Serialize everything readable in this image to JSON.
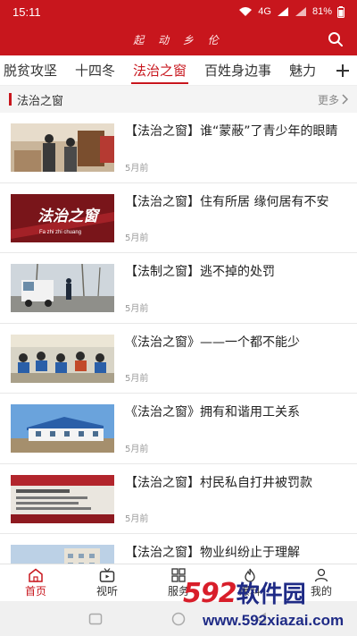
{
  "status": {
    "time": "15:11",
    "network": "4G",
    "battery": "81%"
  },
  "header": {
    "title": "起 动 乡 伦",
    "search_icon": "search-icon",
    "bg_color": "#c8161d"
  },
  "tabs": [
    {
      "label": "脱贫攻坚",
      "active": false
    },
    {
      "label": "十四冬",
      "active": false
    },
    {
      "label": "法治之窗",
      "active": true
    },
    {
      "label": "百姓身边事",
      "active": false
    },
    {
      "label": "魅力",
      "active": false
    }
  ],
  "section": {
    "title": "法治之窗",
    "more": "更多"
  },
  "news": [
    {
      "title": "【法治之窗】谁“蒙蔽”了青少年的眼睛",
      "time": "5月前",
      "thumb": "two-people-office"
    },
    {
      "title": "【法治之窗】住有所居 缘何居有不安",
      "time": "5月前",
      "thumb": "fazhi-banner",
      "thumb_text": "法治之窗",
      "thumb_subtext": "Fa zhi zhi chuang"
    },
    {
      "title": "【法制之窗】逃不掉的处罚",
      "time": "5月前",
      "thumb": "truck-road"
    },
    {
      "title": "《法治之窗》——一个都不能少",
      "time": "5月前",
      "thumb": "classroom"
    },
    {
      "title": "《法治之窗》拥有和谐用工关系",
      "time": "5月前",
      "thumb": "building"
    },
    {
      "title": "【法治之窗】村民私自打井被罚款",
      "time": "5月前",
      "thumb": "notice-board"
    },
    {
      "title": "【法治之窗】物业纠纷止于理解",
      "time": "",
      "thumb": "apartment"
    }
  ],
  "bottom_nav": [
    {
      "label": "首页",
      "icon": "home-icon",
      "active": true
    },
    {
      "label": "视听",
      "icon": "tv-icon",
      "active": false
    },
    {
      "label": "服务",
      "icon": "grid-icon",
      "active": false
    },
    {
      "label": "爆料",
      "icon": "flame-icon",
      "active": false
    },
    {
      "label": "我的",
      "icon": "user-icon",
      "active": false
    }
  ],
  "watermark": {
    "logo": "592",
    "logo_text": "软件园",
    "url": "www.592xiazai.com"
  },
  "colors": {
    "accent": "#c8161d",
    "watermark_red": "#d81e2a",
    "watermark_blue": "#1f2b86"
  }
}
